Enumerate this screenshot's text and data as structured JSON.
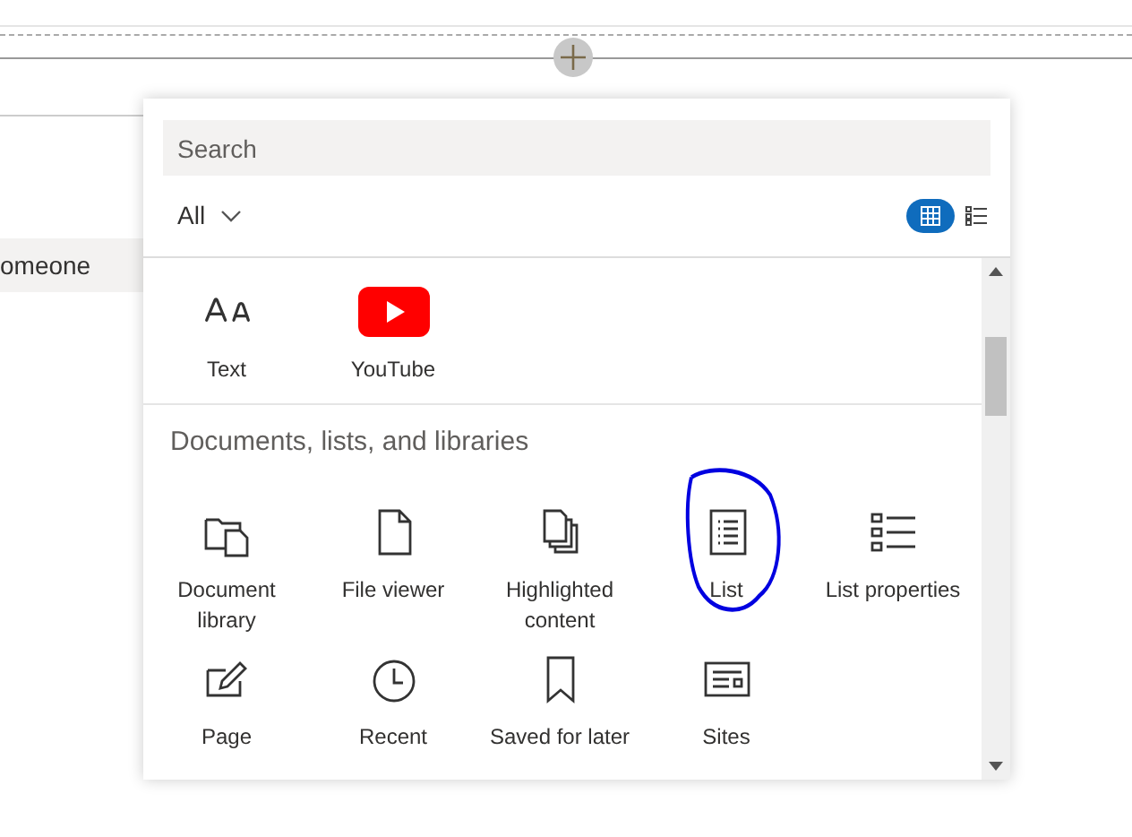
{
  "page": {
    "side_item": "omeone"
  },
  "toolbox": {
    "search": {
      "placeholder": "Search"
    },
    "filter": {
      "label": "All"
    },
    "view_toggle": [
      {
        "kind": "grid",
        "selected": true
      },
      {
        "kind": "list",
        "selected": false
      }
    ],
    "sections": [
      {
        "items": [
          {
            "kind": "text",
            "label": "Text"
          },
          {
            "kind": "youtube",
            "label": "YouTube"
          }
        ]
      },
      {
        "title": "Documents, lists, and libraries",
        "items": [
          {
            "kind": "doclib",
            "label": "Document library"
          },
          {
            "kind": "file",
            "label": "File viewer"
          },
          {
            "kind": "highlighted",
            "label": "Highlighted content"
          },
          {
            "kind": "list",
            "label": "List",
            "annotated": true
          },
          {
            "kind": "listprops",
            "label": "List properties"
          },
          {
            "kind": "page",
            "label": "Page"
          },
          {
            "kind": "recent",
            "label": "Recent"
          },
          {
            "kind": "saved",
            "label": "Saved for later"
          },
          {
            "kind": "sites",
            "label": "Sites"
          }
        ]
      }
    ]
  }
}
